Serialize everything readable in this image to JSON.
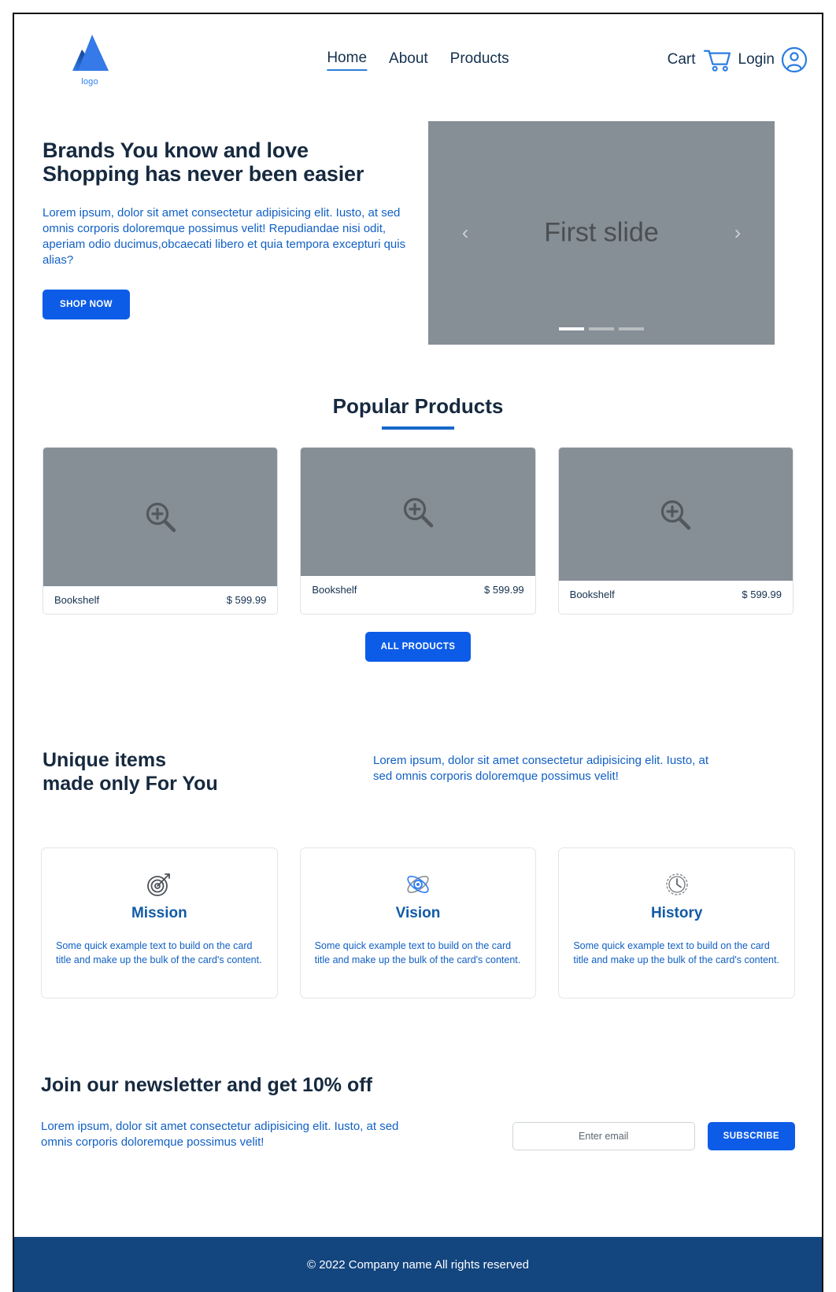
{
  "header": {
    "logo_label": "logo",
    "logo_icon": "atlassian-peaks-logo-icon",
    "nav": [
      {
        "label": "Home",
        "active": true
      },
      {
        "label": "About",
        "active": false
      },
      {
        "label": "Products",
        "active": false
      }
    ],
    "cart_label": "Cart",
    "cart_icon": "shopping-cart-icon",
    "login_label": "Login",
    "login_icon": "user-account-icon"
  },
  "hero": {
    "title_line1": "Brands You know and love",
    "title_line2": "Shopping has never been easier",
    "copy": "Lorem ipsum, dolor sit amet consectetur adipisicing elit. Iusto, at sed omnis corporis doloremque possimus velit! Repudiandae nisi odit, aperiam odio ducimus,obcaecati libero et quia tempora excepturi quis alias?",
    "cta_label": "SHOP NOW",
    "carousel": {
      "caption": "First slide",
      "prev_icon": "chevron-left-icon",
      "next_icon": "chevron-right-icon",
      "slides": 3,
      "active_slide": 1
    }
  },
  "popular": {
    "title": "Popular Products",
    "all_products_label": "ALL PRODUCTS",
    "thumb_icon": "magnifier-plus-icon",
    "products": [
      {
        "name": "Bookshelf",
        "price": "$ 599.99"
      },
      {
        "name": "Bookshelf",
        "price": "$ 599.99"
      },
      {
        "name": "Bookshelf",
        "price": "$ 599.99"
      }
    ]
  },
  "unique": {
    "title_line1": "Unique items",
    "title_line2": "made only For You",
    "copy": "Lorem ipsum, dolor sit amet consectetur adipisicing elit. Iusto, at sed omnis corporis doloremque possimus velit!"
  },
  "features": [
    {
      "icon": "target-bullseye-icon",
      "title": "Mission",
      "text": "Some quick example text to build on the card title and make up the bulk of the card's content."
    },
    {
      "icon": "atom-orbit-icon",
      "title": "Vision",
      "text": "Some quick example text to build on the card title and make up the bulk of the card's content."
    },
    {
      "icon": "clock-history-icon",
      "title": "History",
      "text": "Some quick example text to build on the card title and make up the bulk of the card's content."
    }
  ],
  "newsletter": {
    "title": "Join our newsletter and get 10% off",
    "copy": "Lorem ipsum, dolor sit amet consectetur adipisicing elit. Iusto, at sed omnis corporis doloremque possimus velit!",
    "email_placeholder": "Enter email",
    "email_value": "",
    "subscribe_label": "SUBSCRIBE"
  },
  "footer": {
    "text": "© 2022 Company name  All rights reserved"
  },
  "colors": {
    "brand_blue": "#0d5ce8",
    "navy": "#16293f",
    "link_blue": "#1160c4",
    "footer_navy": "#13457f",
    "placeholder_gray": "#868e96"
  }
}
